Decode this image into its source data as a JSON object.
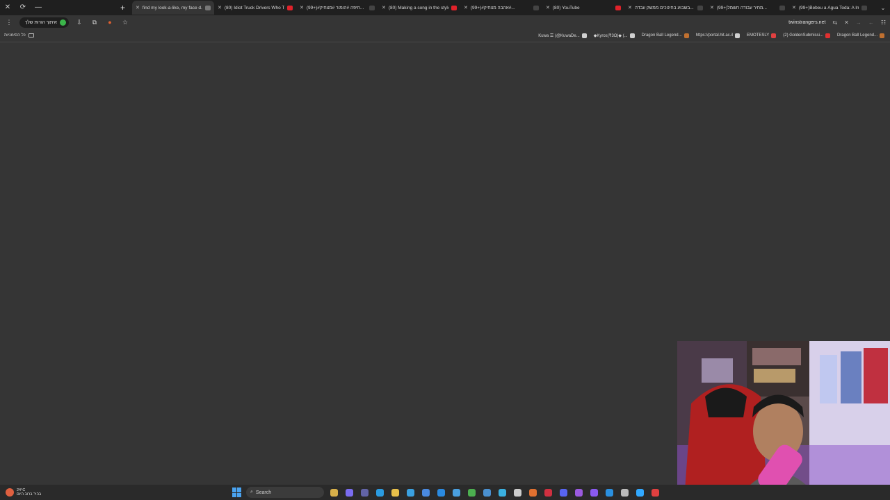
{
  "window_controls": {
    "close": "✕",
    "restore": "⟳",
    "minimize": "—"
  },
  "new_tab_symbol": "+",
  "tabs": [
    {
      "title": "find my look-a-like, my face d...",
      "active": true,
      "color": "#777777"
    },
    {
      "title": "(80) Idiot Truck Drivers Who Te...",
      "active": false,
      "color": "#e0222a"
    },
    {
      "title": "(99+)#חיפה #הומור #מצחיק...",
      "active": false,
      "color": "#444444"
    },
    {
      "title": "(80) Making a song in the style...",
      "active": false,
      "color": "#e0222a"
    },
    {
      "title": "(99+)#אהבה מצחיק#...",
      "active": false,
      "color": "#444444"
    },
    {
      "title": "(80) YouTube",
      "active": false,
      "color": "#e0222a"
    },
    {
      "title": "בשבוע בחינוכים ממשק עבדה...",
      "active": false,
      "color": "#444444"
    },
    {
      "title": "(99+)מחיר עבודה חשמל...",
      "active": false,
      "color": "#444444"
    },
    {
      "title": "(99+)Bebeu a Água Toda: A Im...",
      "active": false,
      "color": "#444444"
    }
  ],
  "toolbar": {
    "profile_label": "איתוך הורות שלך",
    "url": "twinstrangers.net"
  },
  "bookmarks": {
    "all_bookmarks": "כל הסימניות",
    "items": [
      {
        "label": "Kuwa ☰ (@KuwaDe...",
        "color": "#d0d0d0"
      },
      {
        "label": "◆Kyros(₹3Ω)◆ (...",
        "color": "#d0d0d0"
      },
      {
        "label": "Dragon Ball Legend...",
        "color": "#c07030"
      },
      {
        "label": "https://portal.hit.ac.il",
        "color": "#d0d0d0"
      },
      {
        "label": "EMOTESLY",
        "color": "#e04040"
      },
      {
        "label": "(2) GoldenSubmissi...",
        "color": "#e03030"
      },
      {
        "label": "Dragon Ball Legend...",
        "color": "#c07030"
      }
    ]
  },
  "taskbar": {
    "temperature": "24°C",
    "weather_text": "בהיר ברוב היום",
    "search_label": "Search",
    "icons": [
      {
        "name": "file-explorer-icon",
        "color": "#d8b04a"
      },
      {
        "name": "copilot-icon",
        "color": "#7a6cf0"
      },
      {
        "name": "teams-icon",
        "color": "#6264a7"
      },
      {
        "name": "edge-icon",
        "color": "#2a9be0"
      },
      {
        "name": "folder-icon",
        "color": "#e8c04a"
      },
      {
        "name": "app-icon",
        "color": "#3aa0e0"
      },
      {
        "name": "calendar-icon",
        "color": "#4a8ae0"
      },
      {
        "name": "mail-icon",
        "color": "#2a8ae0"
      },
      {
        "name": "photos-icon",
        "color": "#4aa0e0"
      },
      {
        "name": "chrome-icon",
        "color": "#4caf50"
      },
      {
        "name": "steam-icon",
        "color": "#4a90d0"
      },
      {
        "name": "store-icon",
        "color": "#3ab0e0"
      },
      {
        "name": "terminal-icon",
        "color": "#cccccc"
      },
      {
        "name": "firefox-icon",
        "color": "#e07030"
      },
      {
        "name": "opera-icon",
        "color": "#d03040"
      },
      {
        "name": "discord-icon",
        "color": "#5865f2"
      },
      {
        "name": "visual-studio-icon",
        "color": "#9a5adf"
      },
      {
        "name": "messenger-icon",
        "color": "#8a5af0"
      },
      {
        "name": "vscode-icon",
        "color": "#2a90e0"
      },
      {
        "name": "settings-icon",
        "color": "#bbbbbb"
      },
      {
        "name": "photoshop-icon",
        "color": "#31a8ff"
      },
      {
        "name": "app-red-icon",
        "color": "#e04040"
      }
    ]
  }
}
